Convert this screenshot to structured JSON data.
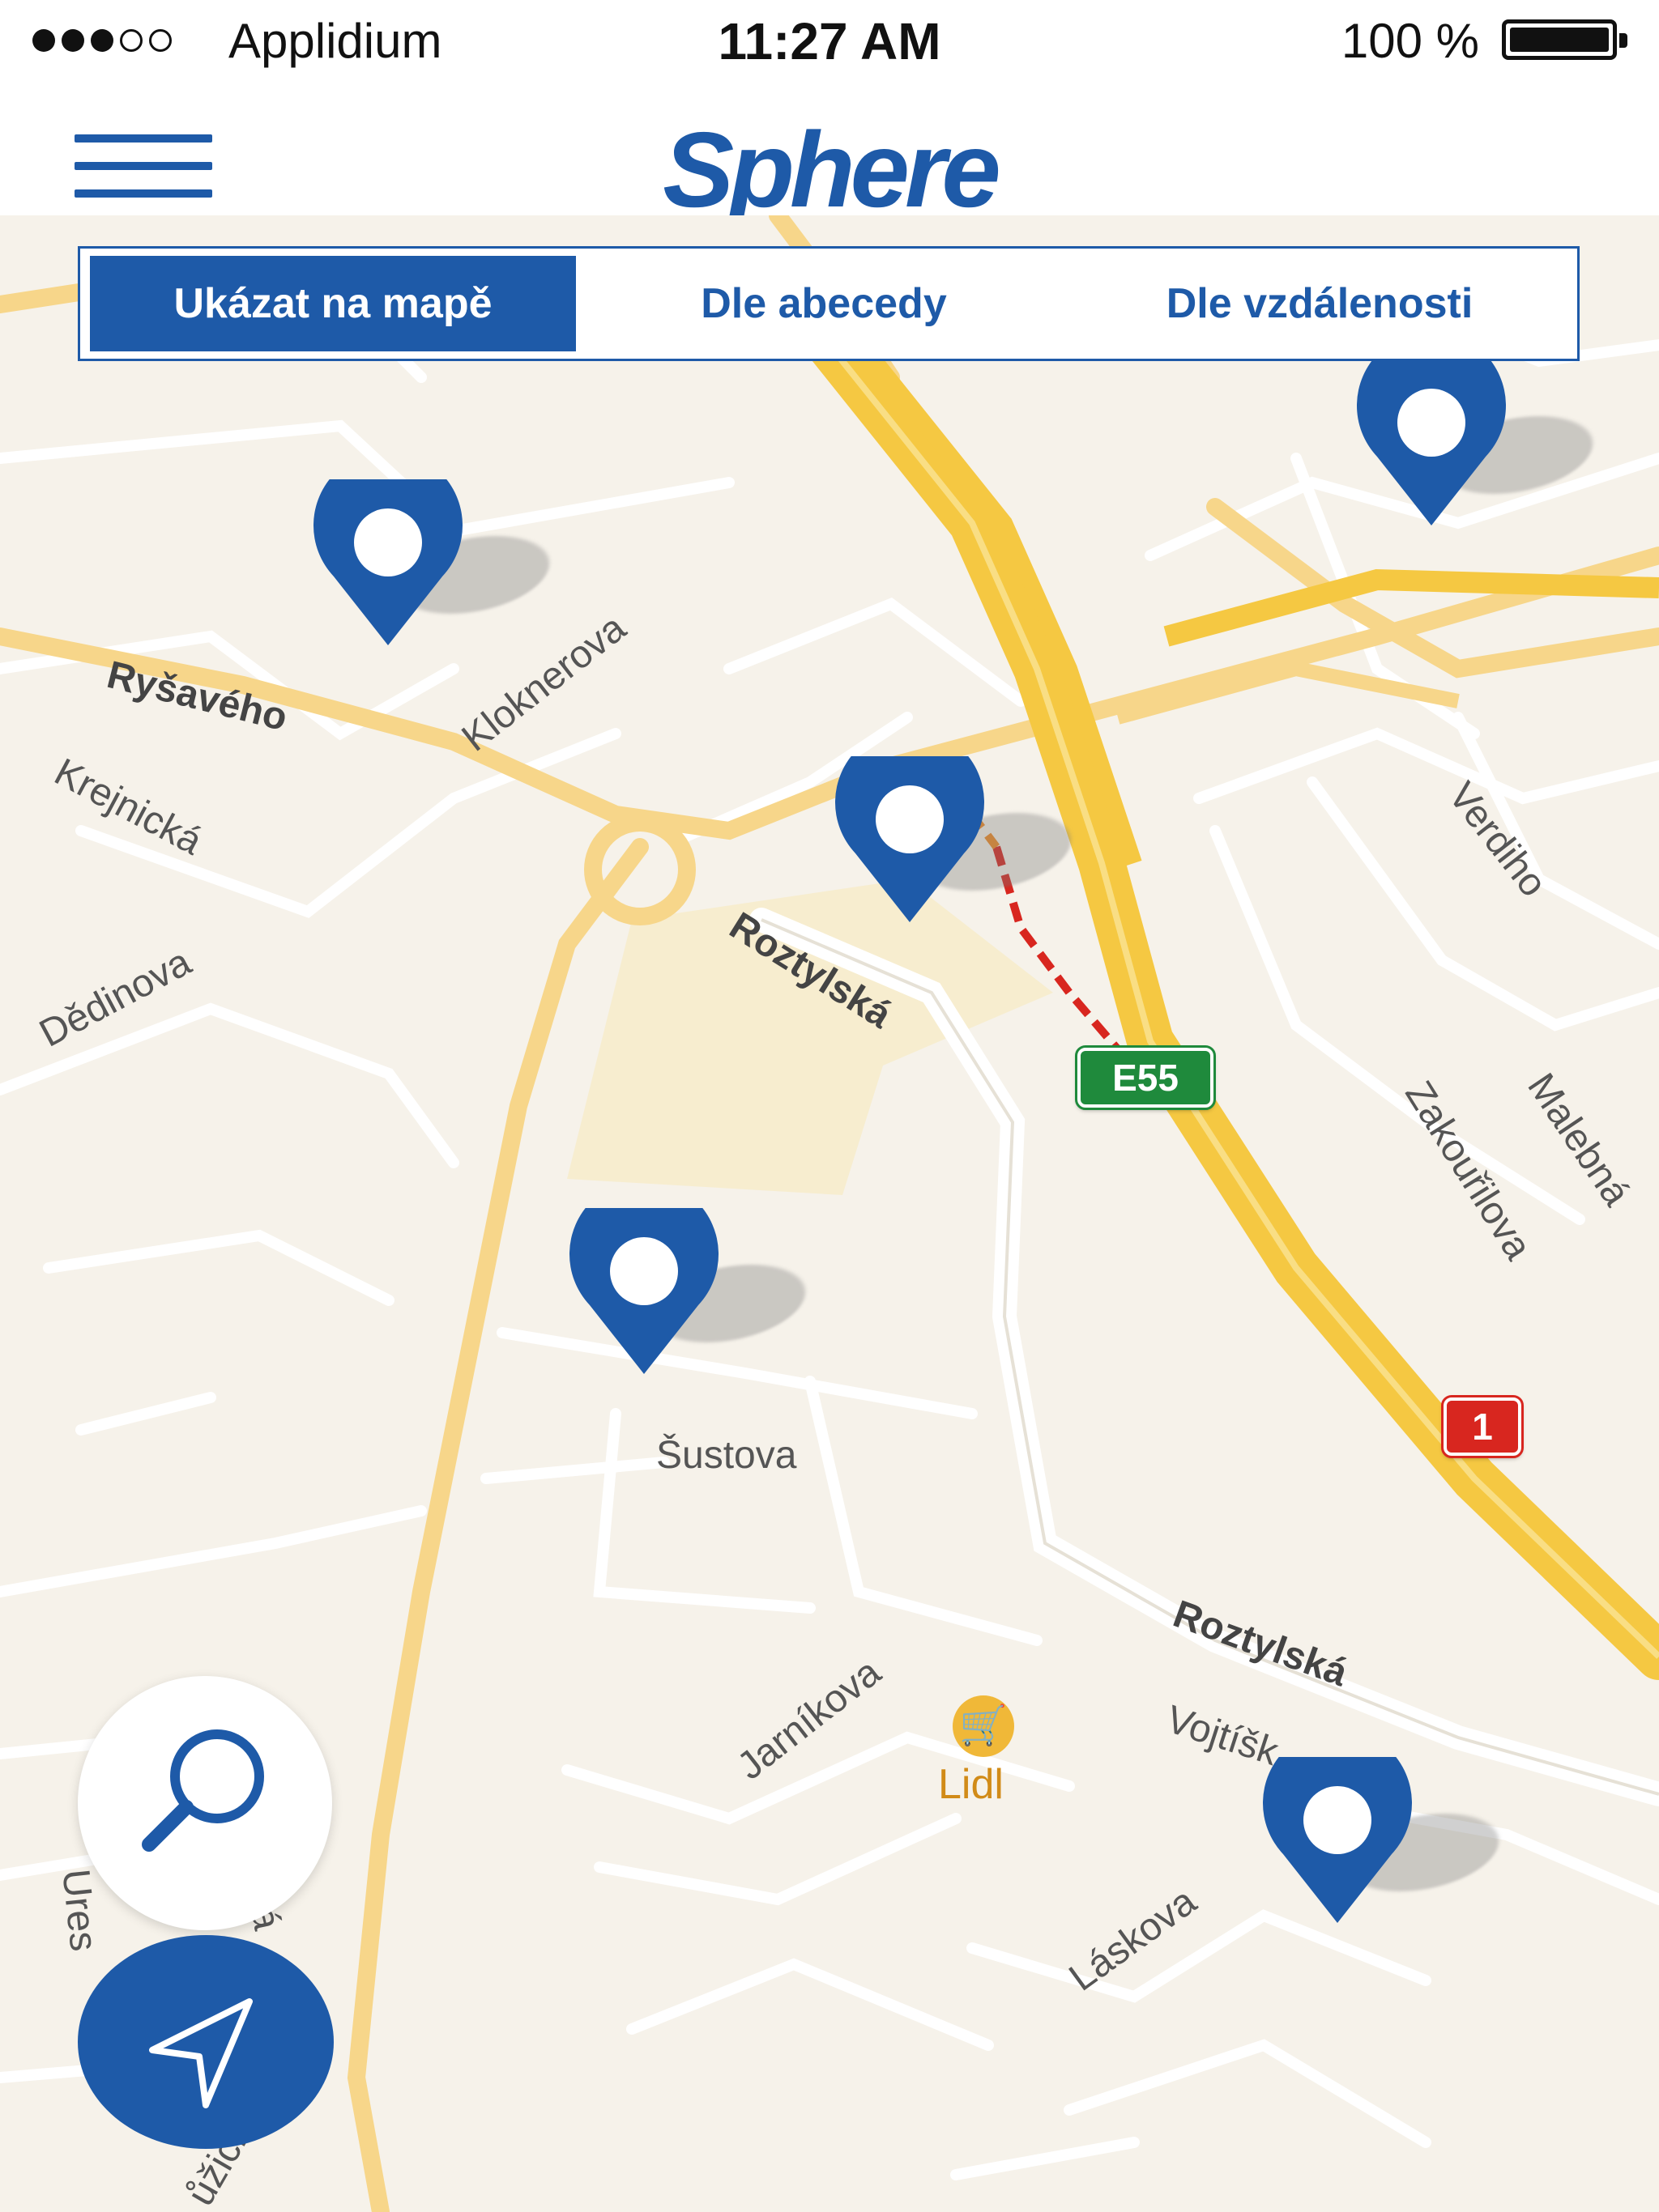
{
  "status_bar": {
    "carrier": "Applidium",
    "time": "11:27 AM",
    "battery": "100 %",
    "signal_bars_filled": 3,
    "signal_bars_total": 5
  },
  "nav": {
    "logo": "Sphere",
    "menu_icon": "hamburger-menu-icon"
  },
  "segmented_control": {
    "options": [
      "Ukázat na mapě",
      "Dle abecedy",
      "Dle vzdálenosti"
    ],
    "selected": "Ukázat na mapě"
  },
  "map": {
    "streets": [
      "Ryšavého",
      "Kloknerova",
      "Krejnická",
      "Dědinova",
      "Roztylská",
      "Verdiho",
      "Zakouřilova",
      "Malebná",
      "Šustova",
      "Jarníkova",
      "Roztylská",
      "Vojtíšk",
      "Láskova",
      "Ures",
      "Kvá",
      "ůžičky"
    ],
    "route_shields": [
      {
        "label": "E55",
        "color": "#1f8a3c"
      },
      {
        "label": "1",
        "color": "#d8261f"
      }
    ],
    "poi": {
      "label": "Lidl",
      "icon": "shopping-cart-icon"
    },
    "pin_count": 5
  },
  "buttons": {
    "search_icon": "magnifier-icon",
    "locate_icon": "navigation-arrow-icon"
  },
  "colors": {
    "brand": "#1e5aa8",
    "map_background": "#f6f2ea",
    "highway": "#f5c842",
    "status_red": "#d8261f",
    "status_green": "#1f8a3c"
  }
}
